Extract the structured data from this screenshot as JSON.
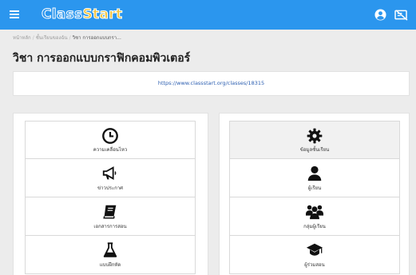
{
  "header": {
    "logo_text": "ClassStart"
  },
  "breadcrumb": {
    "home": "หน้าหลัก",
    "classes": "ชั้นเรียนของฉัน",
    "current": "วิชา การออกแบบกรา..."
  },
  "page": {
    "title": "วิชา การออกแบบกราฟิกคอมพิวเตอร์",
    "url": "https://www.classstart.org/classes/18315"
  },
  "left_menu": [
    {
      "label": "ความเคลื่อนไหว",
      "icon": "clock-icon"
    },
    {
      "label": "ข่าวประกาศ",
      "icon": "megaphone-icon"
    },
    {
      "label": "เอกสารการสอน",
      "icon": "book-icon"
    },
    {
      "label": "แบบฝึกหัด",
      "icon": "flask-icon"
    }
  ],
  "right_menu": [
    {
      "label": "ข้อมูลชั้นเรียน",
      "icon": "gear-icon"
    },
    {
      "label": "ผู้เรียน",
      "icon": "user-icon"
    },
    {
      "label": "กลุ่มผู้เรียน",
      "icon": "users-group-icon"
    },
    {
      "label": "ผู้ร่วมสอน",
      "icon": "graduation-cap-icon"
    }
  ],
  "colors": {
    "topbar": "#2b96ee",
    "logo_accent": "#f4c33b",
    "link": "#2a5db0"
  }
}
